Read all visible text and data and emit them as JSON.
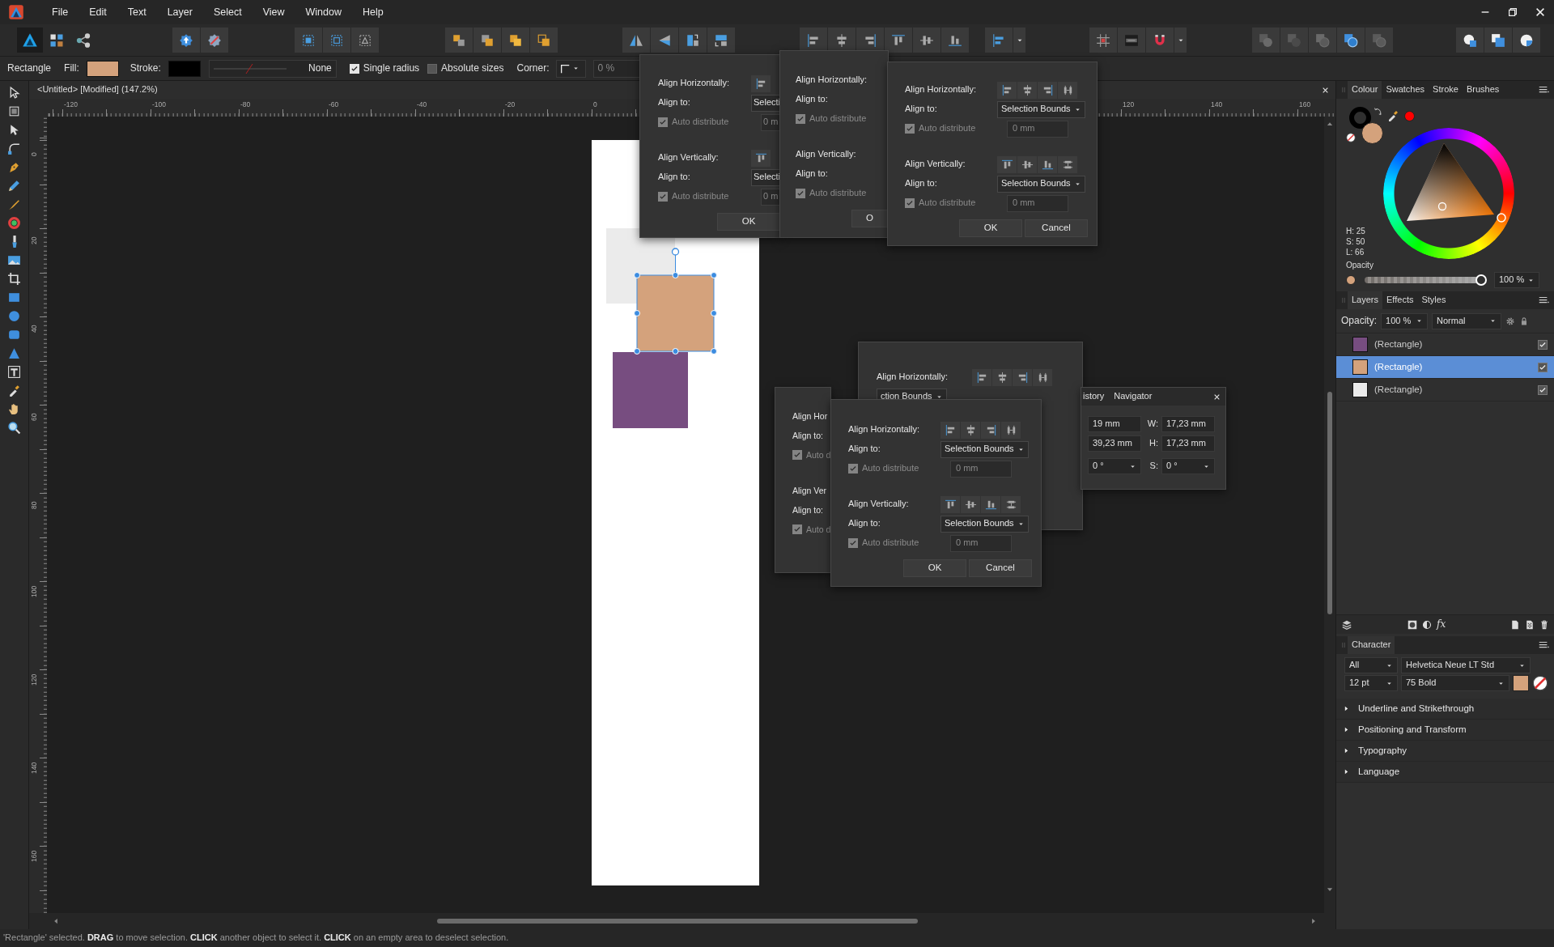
{
  "menu": [
    {
      "label": "File"
    },
    {
      "label": "Edit"
    },
    {
      "label": "Text"
    },
    {
      "label": "Layer"
    },
    {
      "label": "Select"
    },
    {
      "label": "View"
    },
    {
      "label": "Window"
    },
    {
      "label": "Help"
    }
  ],
  "personas": [
    {
      "selected": true
    },
    {
      "selected": false
    },
    {
      "selected": false
    }
  ],
  "context_bar": {
    "tool_name": "Rectangle",
    "fill": {
      "label": "Fill:",
      "color": "#d4a27c"
    },
    "stroke": {
      "label": "Stroke:",
      "color": "#000000",
      "width": "None"
    },
    "options": [
      {
        "label": "Single radius",
        "checked": true
      },
      {
        "label": "Absolute sizes",
        "checked": false
      }
    ],
    "corner": {
      "label": "Corner:",
      "value": "0 %"
    }
  },
  "document": {
    "title": "<Untitled> [Modified] (147.2%)",
    "top_ruler": [
      "-120",
      "-100",
      "-80",
      "-60",
      "-40",
      "-20",
      "0",
      "120",
      "140",
      "160"
    ],
    "left_ruler": [
      "0",
      "20",
      "40",
      "60",
      "80",
      "100",
      "120",
      "140",
      "160"
    ],
    "shapes": [
      {
        "color": "#ebebeb",
        "selected": false
      },
      {
        "color": "#d4a27c",
        "selected": true
      },
      {
        "color": "#774d80",
        "selected": false
      }
    ]
  },
  "align_popups": [
    {
      "sections": [
        [
          {
            "kind": "hicons",
            "label": "Align Horizontally:"
          },
          {
            "kind": "dropdown",
            "label": "Align to:",
            "value": "Selecti"
          },
          {
            "kind": "checkbox",
            "label": "Auto distribute",
            "checked": true,
            "disabled": true,
            "value": "0 m"
          }
        ],
        [
          {
            "kind": "vicons",
            "label": "Align Vertically:"
          },
          {
            "kind": "dropdown",
            "label": "Align to:",
            "value": "Selecti"
          },
          {
            "kind": "checkbox",
            "label": "Auto distribute",
            "checked": true,
            "disabled": true,
            "value": "0 m"
          }
        ]
      ],
      "buttons": [
        "OK"
      ]
    },
    {
      "sections": [
        [
          {
            "kind": "label",
            "label": "Align Horizontally:"
          },
          {
            "kind": "label",
            "label": "Align to:"
          },
          {
            "kind": "checkbox",
            "label": "Auto distribute",
            "checked": true,
            "disabled": true
          }
        ],
        [
          {
            "kind": "label",
            "label": "Align Vertically:"
          },
          {
            "kind": "label",
            "label": "Align to:"
          },
          {
            "kind": "checkbox",
            "label": "Auto distribute",
            "checked": true,
            "disabled": true
          }
        ]
      ],
      "buttons": [
        "O"
      ]
    },
    {
      "sections": [
        [
          {
            "kind": "hicons",
            "label": "Align Horizontally:"
          },
          {
            "kind": "dropdown",
            "label": "Align to:",
            "value": "Selection Bounds"
          },
          {
            "kind": "checkbox",
            "label": "Auto distribute",
            "checked": true,
            "disabled": true,
            "value": "0 mm"
          }
        ],
        [
          {
            "kind": "vicons",
            "label": "Align Vertically:"
          },
          {
            "kind": "dropdown",
            "label": "Align to:",
            "value": "Selection Bounds"
          },
          {
            "kind": "checkbox",
            "label": "Auto distribute",
            "checked": true,
            "disabled": true,
            "value": "0 mm"
          }
        ]
      ],
      "buttons": [
        "OK",
        "Cancel"
      ]
    },
    {
      "sections": [
        [
          {
            "kind": "hicons",
            "label": "Align Horizontally:"
          },
          {
            "kind": "dropdown",
            "value": "ction Bounds"
          }
        ]
      ]
    },
    {
      "sections": [
        [
          {
            "kind": "label",
            "label": "Align Hor"
          },
          {
            "kind": "label",
            "label": "Align to:"
          },
          {
            "kind": "checkbox",
            "label": "Auto d",
            "checked": true,
            "disabled": true
          }
        ],
        [
          {
            "kind": "label",
            "label": "Align Ver"
          },
          {
            "kind": "label",
            "label": "Align to:"
          },
          {
            "kind": "checkbox",
            "label": "Auto d",
            "checked": true,
            "disabled": true
          }
        ]
      ]
    },
    {
      "sections": [
        [
          {
            "kind": "hicons",
            "label": "Align Horizontally:"
          },
          {
            "kind": "dropdown",
            "label": "Align to:",
            "value": "Selection Bounds"
          },
          {
            "kind": "checkbox",
            "label": "Auto distribute",
            "checked": true,
            "disabled": true,
            "value": "0 mm"
          }
        ],
        [
          {
            "kind": "vicons",
            "label": "Align Vertically:"
          },
          {
            "kind": "dropdown",
            "label": "Align to:",
            "value": "Selection Bounds"
          },
          {
            "kind": "checkbox",
            "label": "Auto distribute",
            "checked": true,
            "disabled": true,
            "value": "0 mm"
          }
        ]
      ],
      "buttons": [
        "OK",
        "Cancel"
      ]
    }
  ],
  "transform_panel": {
    "tabs": [
      {
        "label": "istory"
      },
      {
        "label": "Navigator"
      }
    ],
    "rows": [
      [
        {
          "kind": "field",
          "value": "19 mm"
        },
        {
          "kind": "field",
          "label": "W:",
          "value": "17,23 mm"
        }
      ],
      [
        {
          "kind": "field",
          "value": "39,23 mm"
        },
        {
          "kind": "field",
          "label": "H:",
          "value": "17,23 mm"
        }
      ],
      [
        {
          "kind": "dropdown",
          "value": "0 °"
        },
        {
          "kind": "dropdown",
          "label": "S:",
          "value": "0 °"
        }
      ]
    ]
  },
  "colour_panel": {
    "tabs": [
      {
        "label": "Colour",
        "selected": true
      },
      {
        "label": "Swatches",
        "selected": false
      },
      {
        "label": "Stroke",
        "selected": false
      },
      {
        "label": "Brushes",
        "selected": false
      }
    ],
    "swatches": [
      {
        "kind": "stroke",
        "color": "#000000"
      },
      {
        "kind": "fill",
        "color": "#d4a27c"
      },
      {
        "kind": "picker",
        "color": "#ff0000"
      }
    ],
    "hsl": [
      "H: 25",
      "S: 50",
      "L: 66"
    ],
    "opacity": {
      "label": "Opacity",
      "level": 1,
      "value": "100 %"
    }
  },
  "layers_panel": {
    "tabs": [
      {
        "label": "Layers",
        "selected": true
      },
      {
        "label": "Effects",
        "selected": false
      },
      {
        "label": "Styles",
        "selected": false
      }
    ],
    "opacity_label": "Opacity:",
    "opacity_value": "100 %",
    "blend_mode": "Normal",
    "layers": [
      {
        "name": "(Rectangle)",
        "color": "#774d80",
        "selected": false,
        "visible": true
      },
      {
        "name": "(Rectangle)",
        "color": "#d4a27c",
        "selected": true,
        "visible": true
      },
      {
        "name": "(Rectangle)",
        "color": "#ebebeb",
        "selected": false,
        "visible": true
      }
    ],
    "fx_label": "fx"
  },
  "character_panel": {
    "tabs": [
      {
        "label": "Character",
        "selected": true
      }
    ],
    "scope": "All",
    "font": "Helvetica Neue LT Std",
    "size": "12 pt",
    "style": "75 Bold",
    "text_colors": [
      {
        "color": "#d4a27c"
      }
    ],
    "sections": [
      {
        "label": "Underline and Strikethrough",
        "expanded": false
      },
      {
        "label": "Positioning and Transform",
        "expanded": false
      },
      {
        "label": "Typography",
        "expanded": false
      },
      {
        "label": "Language",
        "expanded": false
      }
    ]
  },
  "status_bar": "'Rectangle' selected. **DRAG** to move selection. **CLICK** another object to select it. **CLICK** on an empty area to deselect selection."
}
